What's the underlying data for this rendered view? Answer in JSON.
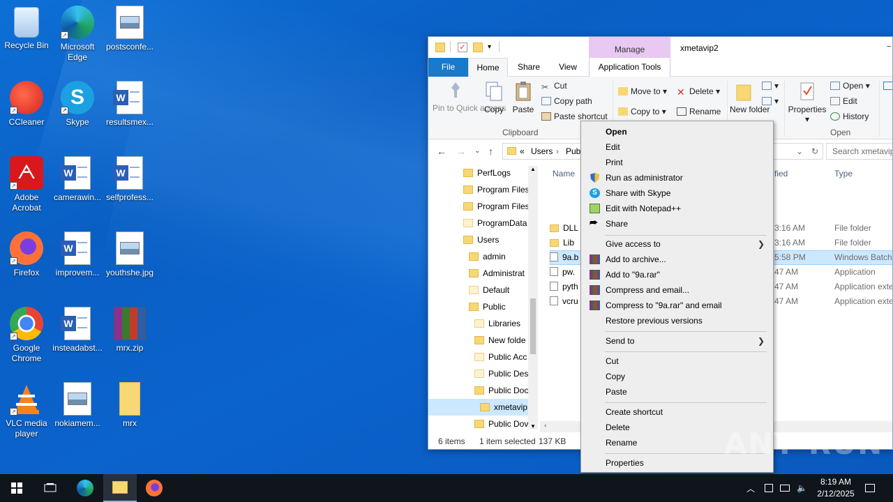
{
  "desktop": {
    "icons": [
      {
        "name": "recycle-bin",
        "label": "Recycle Bin"
      },
      {
        "name": "edge",
        "label": "Microsoft Edge"
      },
      {
        "name": "postsconfe",
        "label": "postsconfe..."
      },
      {
        "name": "ccleaner",
        "label": "CCleaner"
      },
      {
        "name": "skype",
        "label": "Skype"
      },
      {
        "name": "resultsmex",
        "label": "resultsmex..."
      },
      {
        "name": "acrobat",
        "label": "Adobe Acrobat"
      },
      {
        "name": "camerawin",
        "label": "camerawin..."
      },
      {
        "name": "selfprofess",
        "label": "selfprofess..."
      },
      {
        "name": "firefox",
        "label": "Firefox"
      },
      {
        "name": "improvem",
        "label": "improvem..."
      },
      {
        "name": "youthshe",
        "label": "youthshe.jpg"
      },
      {
        "name": "chrome",
        "label": "Google Chrome"
      },
      {
        "name": "insteadabst",
        "label": "insteadabst..."
      },
      {
        "name": "mrx-zip",
        "label": "mrx.zip"
      },
      {
        "name": "vlc",
        "label": "VLC media player"
      },
      {
        "name": "nokiamem",
        "label": "nokiamem..."
      },
      {
        "name": "mrx-folder",
        "label": "mrx"
      }
    ]
  },
  "explorer": {
    "title": "xmetavip2",
    "manage_tab": "Manage",
    "tabs": {
      "file": "File",
      "home": "Home",
      "share": "Share",
      "view": "View",
      "app_tools": "Application Tools"
    },
    "ribbon": {
      "pin": "Pin to Quick access",
      "copy": "Copy",
      "paste": "Paste",
      "cut": "Cut",
      "copy_path": "Copy path",
      "paste_shortcut": "Paste shortcut",
      "clipboard": "Clipboard",
      "move_to": "Move to",
      "copy_to": "Copy to",
      "delete": "Delete",
      "rename": "Rename",
      "new_folder": "New folder",
      "properties": "Properties",
      "open": "Open",
      "edit": "Edit",
      "history": "History",
      "open_group": "Open"
    },
    "address": {
      "prefix": "«",
      "part1": "Users",
      "part2": "Pub"
    },
    "search_placeholder": "Search xmetavip",
    "tree": [
      {
        "label": "PerfLogs",
        "indent": 0,
        "pale": false
      },
      {
        "label": "Program Files",
        "indent": 0,
        "pale": false
      },
      {
        "label": "Program Files",
        "indent": 0,
        "pale": false
      },
      {
        "label": "ProgramData",
        "indent": 0,
        "pale": true
      },
      {
        "label": "Users",
        "indent": 0,
        "pale": false
      },
      {
        "label": "admin",
        "indent": 1,
        "pale": false
      },
      {
        "label": "Administrat",
        "indent": 1,
        "pale": false
      },
      {
        "label": "Default",
        "indent": 1,
        "pale": true
      },
      {
        "label": "Public",
        "indent": 1,
        "pale": false
      },
      {
        "label": "Libraries",
        "indent": 2,
        "pale": true
      },
      {
        "label": "New folde",
        "indent": 2,
        "pale": false
      },
      {
        "label": "Public Acc",
        "indent": 2,
        "pale": true
      },
      {
        "label": "Public Des",
        "indent": 2,
        "pale": true
      },
      {
        "label": "Public Doc",
        "indent": 2,
        "pale": false
      },
      {
        "label": "xmetavip",
        "indent": 3,
        "pale": false
      },
      {
        "label": "Public Dov",
        "indent": 2,
        "pale": false
      }
    ],
    "columns": {
      "name": "Name",
      "modified": "fied",
      "type": "Type"
    },
    "files": [
      {
        "name": "DLL",
        "modified": "3:16 AM",
        "type": "File folder",
        "kind": "folder"
      },
      {
        "name": "Lib",
        "modified": "3:16 AM",
        "type": "File folder",
        "kind": "folder"
      },
      {
        "name": "9a.b",
        "modified": "5:58 PM",
        "type": "Windows Batch",
        "kind": "file"
      },
      {
        "name": "pw.",
        "modified": "47 AM",
        "type": "Application",
        "kind": "file"
      },
      {
        "name": "pyth",
        "modified": "47 AM",
        "type": "Application exte",
        "kind": "file"
      },
      {
        "name": "vcru",
        "modified": "47 AM",
        "type": "Application exte",
        "kind": "file"
      }
    ],
    "status": {
      "items": "6 items",
      "selected": "1 item selected",
      "size": "137 KB"
    }
  },
  "context_menu": {
    "open": "Open",
    "edit": "Edit",
    "print": "Print",
    "run_as_admin": "Run as administrator",
    "share_skype": "Share with Skype",
    "edit_notepad": "Edit with Notepad++",
    "share": "Share",
    "give_access": "Give access to",
    "add_archive": "Add to archive...",
    "add_rar": "Add to \"9a.rar\"",
    "compress_email": "Compress and email...",
    "compress_rar_email": "Compress to \"9a.rar\" and email",
    "restore": "Restore previous versions",
    "send_to": "Send to",
    "cut": "Cut",
    "copy": "Copy",
    "paste": "Paste",
    "create_shortcut": "Create shortcut",
    "delete": "Delete",
    "rename": "Rename",
    "properties": "Properties"
  },
  "watermark": "ANY RUN",
  "taskbar": {
    "time": "8:19 AM",
    "date": "2/12/2025"
  }
}
